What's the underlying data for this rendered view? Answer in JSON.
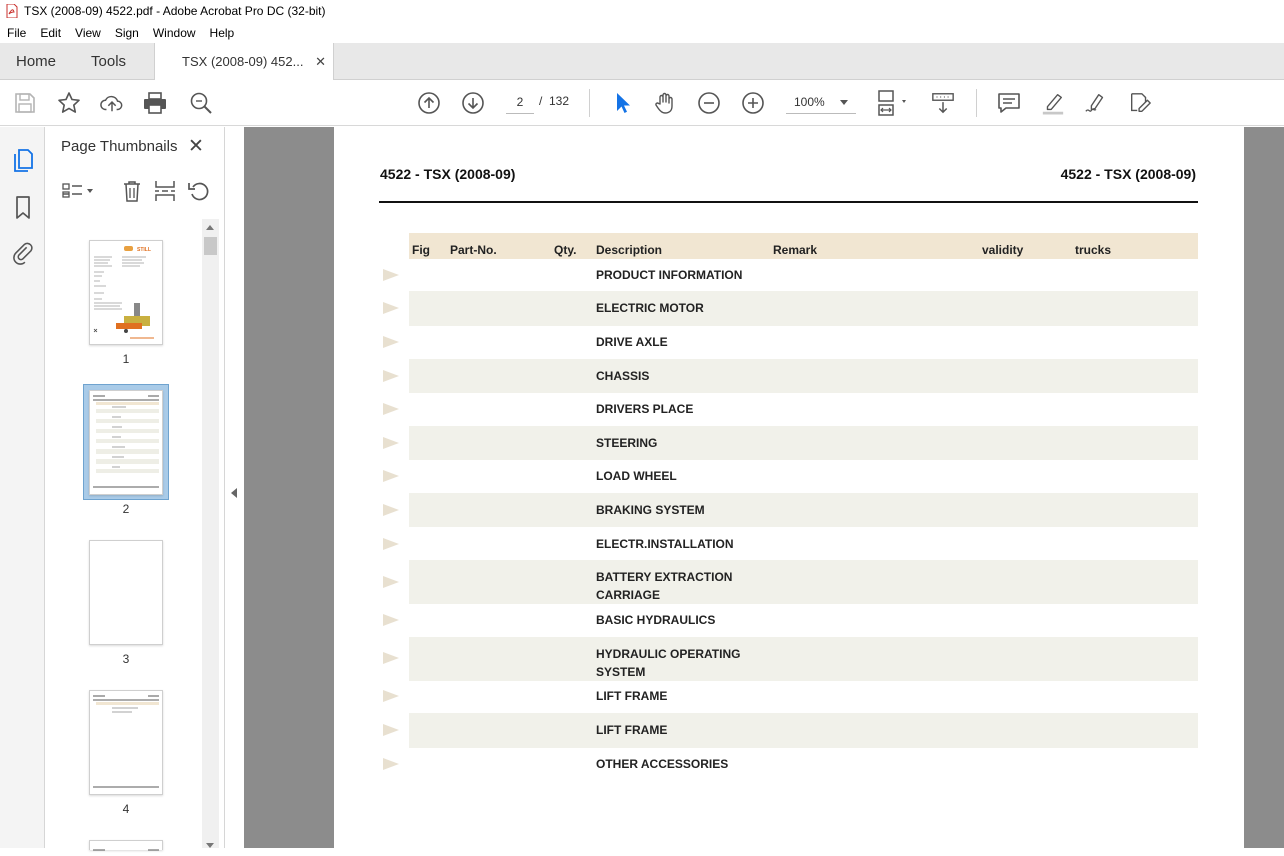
{
  "window": {
    "title": "TSX (2008-09) 4522.pdf - Adobe Acrobat Pro DC (32-bit)"
  },
  "menu": [
    "File",
    "Edit",
    "View",
    "Sign",
    "Window",
    "Help"
  ],
  "tabs": {
    "home": "Home",
    "tools": "Tools",
    "document": "TSX (2008-09) 452...",
    "close": "✕"
  },
  "toolbar": {
    "current_page": "2",
    "separator": "/",
    "total_pages": "132",
    "zoom": "100%"
  },
  "thumbnails_panel": {
    "title": "Page Thumbnails",
    "close": "✕",
    "pages": [
      "1",
      "2",
      "3",
      "4"
    ],
    "selected_page": "2"
  },
  "document": {
    "header_left": "4522 - TSX (2008-09)",
    "header_right": "4522 - TSX (2008-09)",
    "columns": {
      "fig": "Fig",
      "part_no": "Part-No.",
      "qty": "Qty.",
      "description": "Description",
      "remark": "Remark",
      "validity": "validity",
      "trucks": "trucks"
    },
    "rows": [
      {
        "description": "PRODUCT INFORMATION"
      },
      {
        "description": "ELECTRIC MOTOR"
      },
      {
        "description": "DRIVE AXLE"
      },
      {
        "description": "CHASSIS"
      },
      {
        "description": "DRIVERS PLACE"
      },
      {
        "description": "STEERING"
      },
      {
        "description": "LOAD WHEEL"
      },
      {
        "description": "BRAKING SYSTEM"
      },
      {
        "description": "ELECTR.INSTALLATION"
      },
      {
        "description": "BATTERY EXTRACTION CARRIAGE"
      },
      {
        "description": "BASIC HYDRAULICS"
      },
      {
        "description": "HYDRAULIC OPERATING SYSTEM"
      },
      {
        "description": "LIFT FRAME"
      },
      {
        "description": "LIFT FRAME"
      },
      {
        "description": "OTHER ACCESSORIES"
      }
    ]
  },
  "colors": {
    "header_band": "#f1e6d2",
    "row_shade": "#f1f1ea",
    "workspace": "#8c8c8c",
    "pdf_red": "#d9261c",
    "select_blue": "#1473e6"
  }
}
